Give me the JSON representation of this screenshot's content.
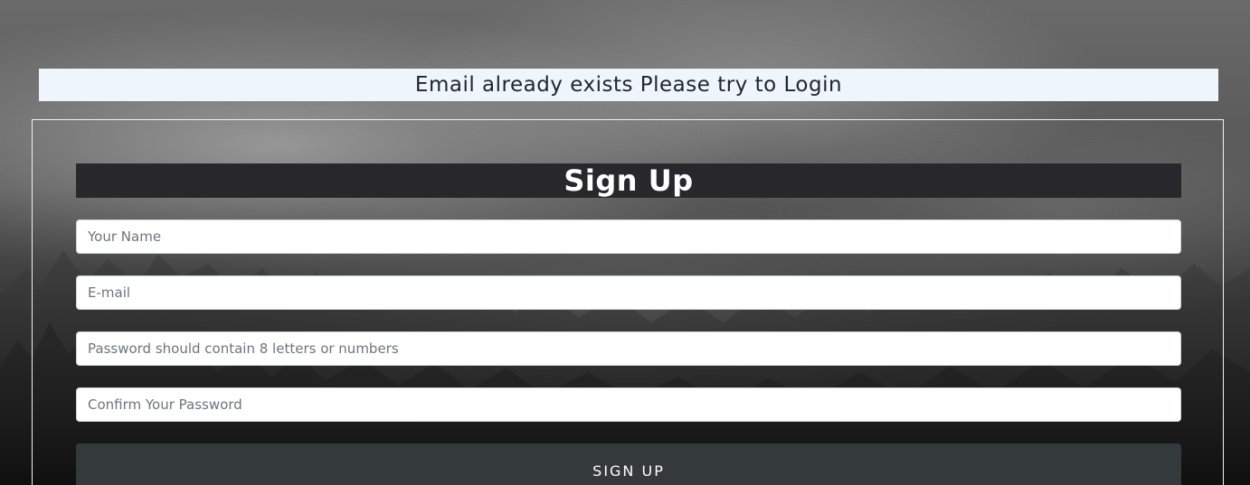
{
  "alert": {
    "message": "Email already exists Please try to Login"
  },
  "signup_form": {
    "title": "Sign Up",
    "name_placeholder": "Your Name",
    "email_placeholder": "E-mail",
    "password_placeholder": "Password should contain 8 letters or numbers",
    "confirm_placeholder": "Confirm Your Password",
    "submit_label": "SIGN UP"
  }
}
